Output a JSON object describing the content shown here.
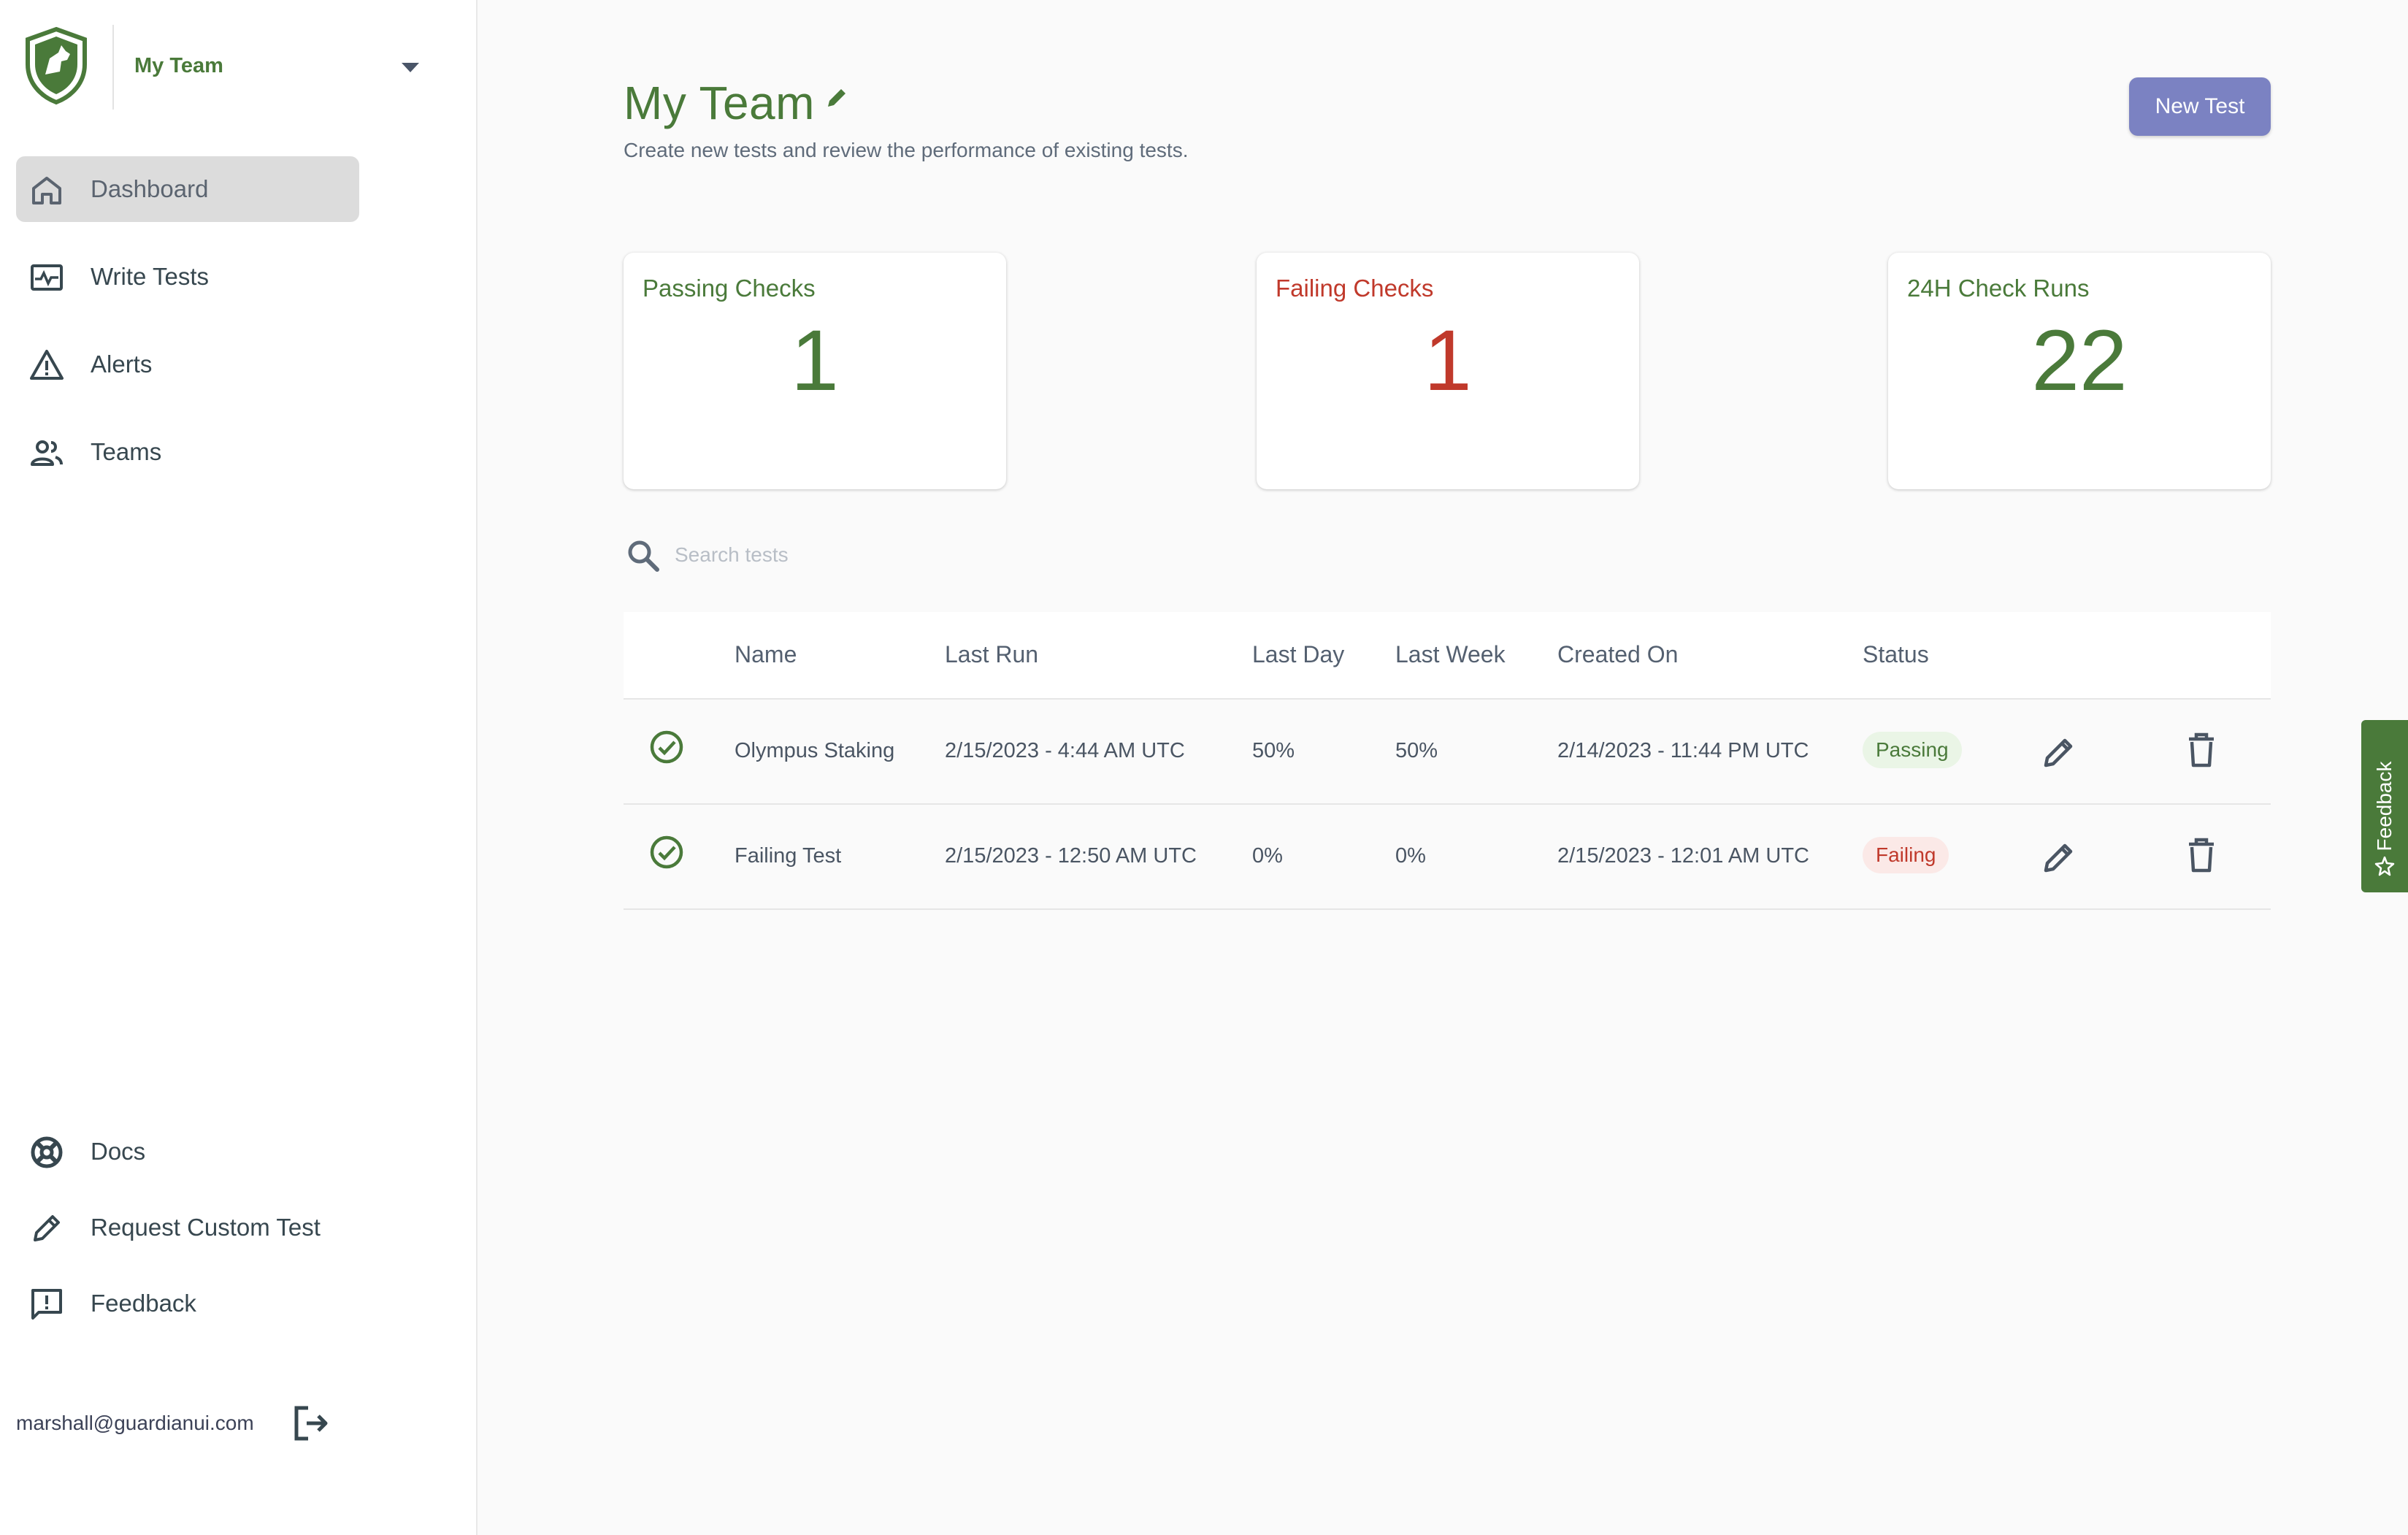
{
  "sidebar": {
    "team_selector": {
      "name": "My Team"
    },
    "nav": [
      {
        "label": "Dashboard",
        "icon": "home-icon",
        "active": true
      },
      {
        "label": "Write Tests",
        "icon": "write-tests-icon",
        "active": false
      },
      {
        "label": "Alerts",
        "icon": "alert-icon",
        "active": false
      },
      {
        "label": "Teams",
        "icon": "teams-icon",
        "active": false
      }
    ],
    "bottom_nav": [
      {
        "label": "Docs",
        "icon": "lifebuoy-icon"
      },
      {
        "label": "Request Custom Test",
        "icon": "pencil-icon"
      },
      {
        "label": "Feedback",
        "icon": "feedback-icon"
      }
    ],
    "user": {
      "email": "marshall@guardianui.com"
    }
  },
  "header": {
    "title": "My Team",
    "subtitle": "Create new tests and review the performance of existing tests.",
    "new_test_label": "New Test"
  },
  "stats": [
    {
      "label": "Passing Checks",
      "value": "1",
      "color": "#4a7a3a"
    },
    {
      "label": "Failing Checks",
      "value": "1",
      "color": "#c0392b"
    },
    {
      "label": "24H Check Runs",
      "value": "22",
      "color": "#4a7a3a"
    }
  ],
  "search": {
    "placeholder": "Search tests"
  },
  "table": {
    "columns": [
      "Name",
      "Last Run",
      "Last Day",
      "Last Week",
      "Created On",
      "Status"
    ],
    "rows": [
      {
        "name": "Olympus Staking",
        "last_run": "2/15/2023 - 4:44 AM UTC",
        "last_day": "50%",
        "last_week": "50%",
        "created_on": "2/14/2023 - 11:44 PM UTC",
        "status": "Passing"
      },
      {
        "name": "Failing Test",
        "last_run": "2/15/2023 - 12:50 AM UTC",
        "last_day": "0%",
        "last_week": "0%",
        "created_on": "2/15/2023 - 12:01 AM UTC",
        "status": "Failing"
      }
    ]
  },
  "feedback_tab": {
    "label": "Feedback"
  },
  "colors": {
    "brand_green": "#4a7a3a",
    "fail_red": "#c0392b",
    "button_purple": "#7b82c2"
  }
}
